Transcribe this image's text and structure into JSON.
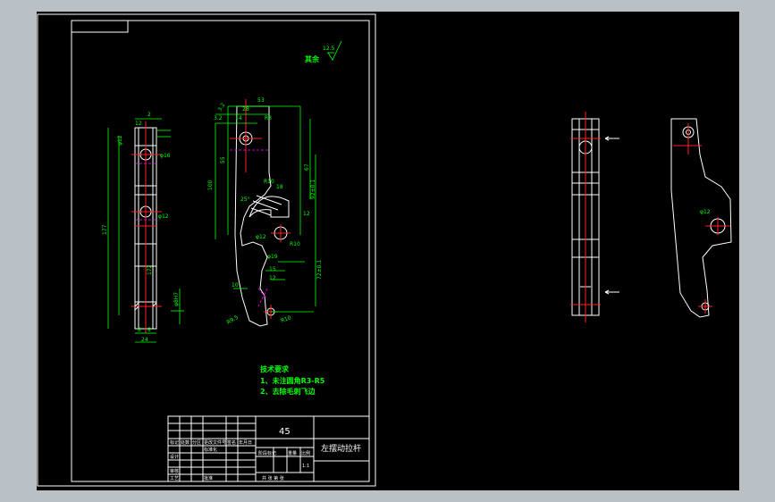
{
  "colors": {
    "background": "#000000",
    "border": "#ffffff",
    "dimension": "#00ff00",
    "centerline": "#ff2020",
    "hidden": "#ff00ff",
    "app_frame": "#b9c0c6"
  },
  "roughness": {
    "value": "12.5",
    "label": "其余"
  },
  "dims_left": {
    "d2": "2",
    "d12a": "12",
    "d_phi12": "φ12",
    "d_phi16": "φ16",
    "d_phi12b": "φ12",
    "d177": "177",
    "d172": "172",
    "d_phi8h7": "φ8H7",
    "d8a": "8",
    "d8b": "8",
    "d24": "24"
  },
  "dims_right": {
    "d53": "53",
    "d28": "28",
    "d14": "14",
    "d3_2a": "3.2",
    "d3_2b": "3.2",
    "dR3": "R3",
    "d55": "55",
    "d100": "100",
    "d67": "67",
    "dR10a": "R10",
    "d18": "18",
    "d25": "25°",
    "d92": "92±0.1",
    "d12": "12",
    "d_phi12": "φ12",
    "dR10b": "R10",
    "d_phi19": "φ19",
    "d15": "15",
    "d12b": "12",
    "d10": "10",
    "d72": "72±0.1",
    "dR9_5": "R9.5",
    "dR10c": "R10"
  },
  "tech": {
    "title": "技术要求",
    "line1": "1、未注圆角R3-R5",
    "line2": "2、去除毛刺飞边"
  },
  "title_block": {
    "material": "45",
    "part_name": "左摆动拉杆",
    "scale": "1:1",
    "row_labels": [
      "标记",
      "处数",
      "分区",
      "更改文件号",
      "签名",
      "年月日"
    ],
    "label_design": "设计",
    "label_std": "标准化",
    "label_check": "审核",
    "label_craft": "工艺",
    "label_approve": "批准",
    "label_stage": "阶段标记",
    "label_weight": "重量",
    "label_ratio": "比例",
    "label_sheet": "共 张 第 张"
  }
}
